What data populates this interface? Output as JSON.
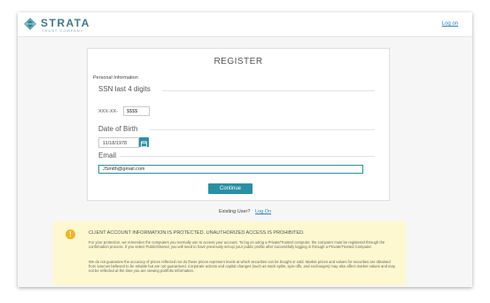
{
  "header": {
    "brand_name": "STRATA",
    "brand_sub": "TRUST COMPANY",
    "login_link": "Log on"
  },
  "form": {
    "title": "REGISTER",
    "section_label": "Personal Information",
    "ssn": {
      "label": "SSN last 4 digits",
      "prefix": "XXX-XX-",
      "value": "$$$$"
    },
    "dob": {
      "label": "Date of Birth",
      "value": "11/18/1978"
    },
    "email": {
      "label": "Email",
      "value": "JSmith@gmail.com"
    },
    "continue_label": "Continue"
  },
  "existing_user": {
    "text": "Existing User?",
    "link": "Log On"
  },
  "notice": {
    "title": "CLIENT ACCOUNT INFORMATION IS PROTECTED. UNAUTHORIZED ACCESS IS PROHIBITED.",
    "paragraph1": "For your protection, we remember the computers you normally use to access your account. To log on using a Private/Trusted computer, the computer must be registered through the confirmation process. If you select Public/Shared, you will need to have previously set-up your public profile after successfully logging in through a Private/Trusted Computer.",
    "paragraph2": "We do not guarantee the accuracy of prices reflected nor do these prices represent levels at which securities can be bought or sold. Market prices and values for securities are obtained from sources believed to be reliable but are not guaranteed. Corporate actions and capital changes (such as stock splits, spin-offs, and exchanges) may also affect market values and may not be reflected at the time you are viewing portfolio information."
  },
  "colors": {
    "accent": "#2a8fa4",
    "link": "#2f7fb5",
    "notice_bg": "#fdf8cf",
    "warning_icon": "#f4b224"
  },
  "icons": {
    "logo": "strata-logo-icon",
    "calendar": "calendar-icon",
    "warning": "warning-icon"
  }
}
